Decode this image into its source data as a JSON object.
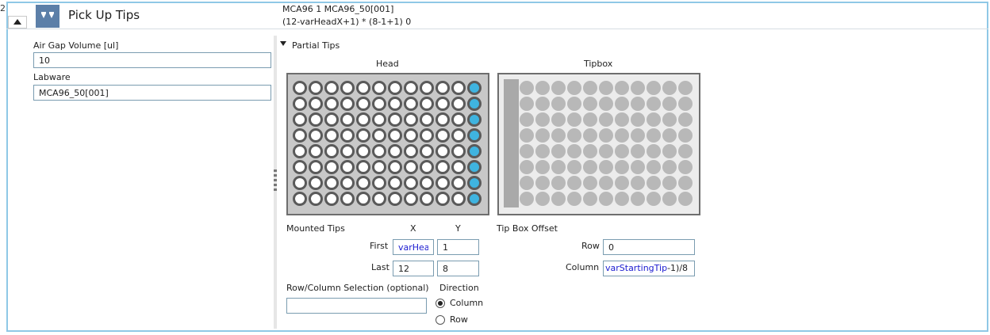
{
  "step": {
    "number": "2",
    "title": "Pick Up Tips",
    "summary_line1": "MCA96 1 MCA96_50[001]",
    "summary_line2": "(12-varHeadX+1) * (8-1+1) 0",
    "icon": "pick-up-tips-icon"
  },
  "left_panel": {
    "air_gap_label": "Air Gap Volume [ul]",
    "air_gap_value": "10",
    "labware_label": "Labware",
    "labware_value": "MCA96_50[001]"
  },
  "partial_tips": {
    "section_label": "Partial Tips",
    "head_label": "Head",
    "tipbox_label": "Tipbox",
    "head_grid": {
      "rows": 8,
      "cols": 12,
      "highlighted_col": 12
    },
    "tipbox_grid": {
      "rows": 8,
      "cols": 12,
      "highlighted_col": 1
    },
    "mounted_tips_label": "Mounted Tips",
    "x_label": "X",
    "y_label": "Y",
    "first_label": "First",
    "first_x": "varHeadX",
    "first_y": "1",
    "last_label": "Last",
    "last_x": "12",
    "last_y": "8",
    "tip_box_offset_label": "Tip Box Offset",
    "row_label": "Row",
    "row_value": "0",
    "column_label": "Column",
    "column_value_var": "varStartingTip",
    "column_value_rest": "-1)/8",
    "rowcol_selection_label": "Row/Column Selection (optional)",
    "rowcol_selection_value": "",
    "direction_label": "Direction",
    "direction_options": [
      "Column",
      "Row"
    ],
    "direction_selected": "Column"
  },
  "colors": {
    "accent_border": "#8fc8e6",
    "highlight_well": "#3fb4e0",
    "variable_text": "#1b1bd0",
    "step_icon_bg": "#5c7fa8"
  }
}
